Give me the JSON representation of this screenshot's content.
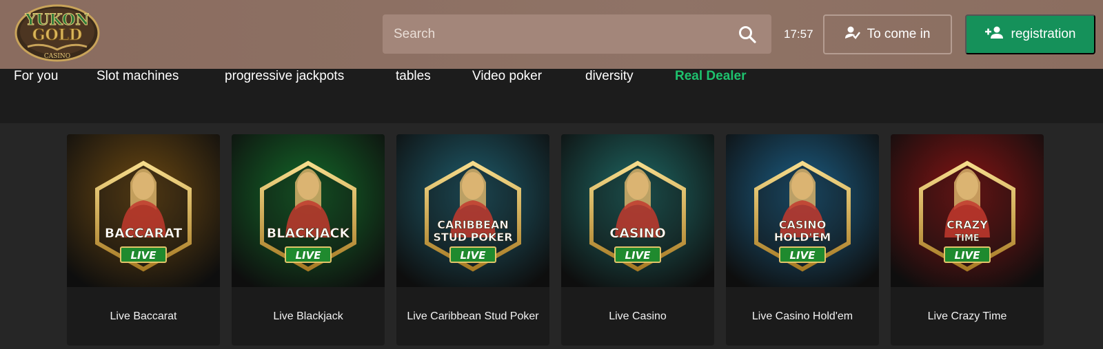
{
  "header": {
    "logo_text": {
      "line1": "YUKON",
      "line2": "GOLD",
      "line3": "CASINO"
    },
    "search": {
      "placeholder": "Search"
    },
    "clock": "17:57",
    "login_label": "To come in",
    "register_label": "registration"
  },
  "nav": {
    "items": [
      {
        "label": "For you"
      },
      {
        "label": "Slot machines"
      },
      {
        "label": "progressive jackpots"
      },
      {
        "label": "tables"
      },
      {
        "label": "Video poker"
      },
      {
        "label": "diversity"
      },
      {
        "label": "Real Dealer",
        "active": true
      }
    ]
  },
  "games": [
    {
      "title": "Live Baccarat",
      "badge_line1": "BACCARAT",
      "badge_line2": "",
      "live": "LIVE",
      "bg": "#6e4a12"
    },
    {
      "title": "Live Blackjack",
      "badge_line1": "BLACKJACK",
      "badge_line2": "",
      "live": "LIVE",
      "bg": "#146b2a"
    },
    {
      "title": "Live Caribbean Stud Poker",
      "badge_line1": "CARIBBEAN",
      "badge_line2": "STUD POKER",
      "live": "LIVE",
      "bg": "#1f5e6e"
    },
    {
      "title": "Live Casino",
      "badge_line1": "CASINO",
      "badge_line2": "",
      "live": "LIVE",
      "bg": "#1f6a66"
    },
    {
      "title": "Live Casino Hold'em",
      "badge_line1": "CASINO",
      "badge_line2": "HOLD'EM",
      "live": "LIVE",
      "bg": "#1c5f86"
    },
    {
      "title": "Live Crazy Time",
      "badge_line1": "CRAZY",
      "badge_line2": "TIME",
      "live": "LIVE",
      "bg": "#8a1414"
    }
  ],
  "colors": {
    "accent_green": "#15915a",
    "active_nav": "#1ec26e",
    "header_bg": "#8b6f62",
    "gold": "#e3b75a"
  }
}
